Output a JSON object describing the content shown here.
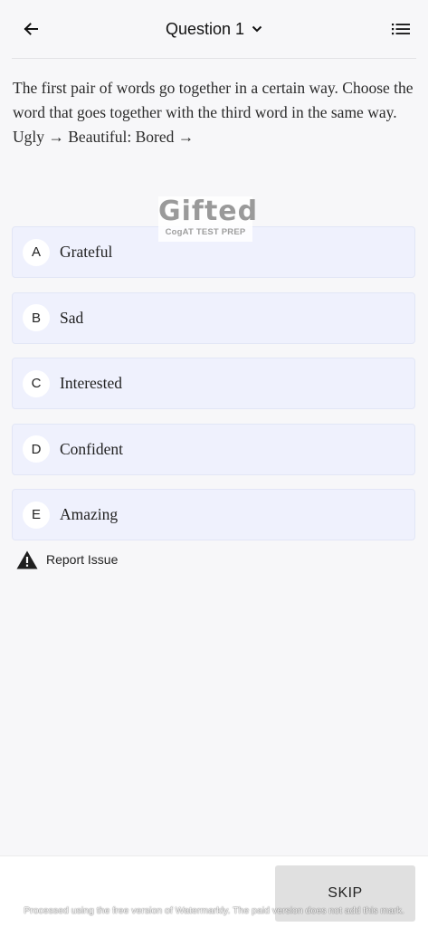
{
  "header": {
    "title": "Question 1",
    "back_icon": "arrow-left-icon",
    "dropdown_icon": "chevron-down-icon",
    "menu_icon": "list-icon"
  },
  "question": {
    "prompt": "The first pair of words go together in a certain way. Choose the word that goes together with the third word in the same way.",
    "analogy": "Ugly → Beautiful: Bored →"
  },
  "watermark_logo": {
    "name": "Gifted",
    "tagline": "CogAT TEST PREP"
  },
  "options": [
    {
      "letter": "A",
      "text": "Grateful"
    },
    {
      "letter": "B",
      "text": "Sad"
    },
    {
      "letter": "C",
      "text": "Interested"
    },
    {
      "letter": "D",
      "text": "Confident"
    },
    {
      "letter": "E",
      "text": "Amazing"
    }
  ],
  "report": {
    "label": "Report Issue",
    "icon": "warning-icon"
  },
  "footer": {
    "skip_label": "SKIP",
    "watermark_notice": "Processed using the free version of Watermarkly. The paid version does not add this mark."
  },
  "colors": {
    "background": "#f7f7f9",
    "option_background": "#eff1fd",
    "skip_background": "#e0e0e0"
  }
}
